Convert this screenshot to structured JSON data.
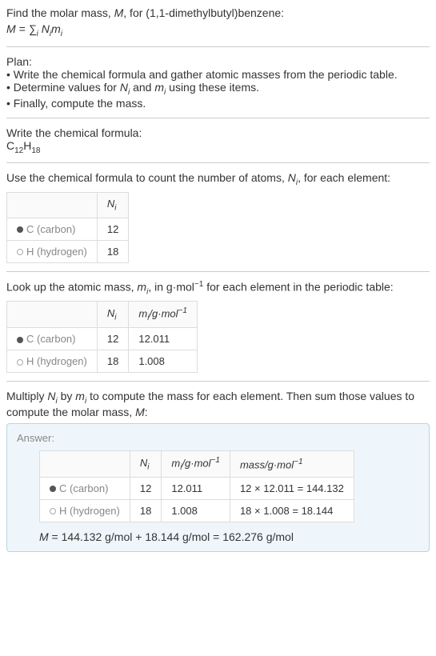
{
  "intro": {
    "line1_pre": "Find the molar mass, ",
    "line1_var": "M",
    "line1_post": ", for (1,1-dimethylbutyl)benzene:",
    "formula_lhs": "M = ",
    "formula_sum": "∑",
    "formula_sub": "i",
    "formula_rhs_pre": " N",
    "formula_rhs_sub1": "i",
    "formula_rhs_mid": "m",
    "formula_rhs_sub2": "i"
  },
  "plan": {
    "title": "Plan:",
    "item1": "• Write the chemical formula and gather atomic masses from the periodic table.",
    "item2_pre": "• Determine values for ",
    "item2_n": "N",
    "item2_nsub": "i",
    "item2_mid": " and ",
    "item2_m": "m",
    "item2_msub": "i",
    "item2_post": " using these items.",
    "item3": "• Finally, compute the mass."
  },
  "chemFormula": {
    "title": "Write the chemical formula:",
    "c": "C",
    "c_sub": "12",
    "h": "H",
    "h_sub": "18"
  },
  "countAtoms": {
    "intro_pre": "Use the chemical formula to count the number of atoms, ",
    "intro_n": "N",
    "intro_nsub": "i",
    "intro_post": ", for each element:",
    "header_n": "N",
    "header_nsub": "i",
    "rows": [
      {
        "name": "C (carbon)",
        "dot": "dot-c",
        "n": "12"
      },
      {
        "name": "H (hydrogen)",
        "dot": "dot-h",
        "n": "18"
      }
    ]
  },
  "atomicMass": {
    "intro_pre": "Look up the atomic mass, ",
    "intro_m": "m",
    "intro_msub": "i",
    "intro_mid": ", in g·mol",
    "intro_sup": "−1",
    "intro_post": " for each element in the periodic table:",
    "header_n": "N",
    "header_nsub": "i",
    "header_m": "m",
    "header_msub": "i",
    "header_unit": "/g·mol",
    "header_sup": "−1",
    "rows": [
      {
        "name": "C (carbon)",
        "dot": "dot-c",
        "n": "12",
        "m": "12.011"
      },
      {
        "name": "H (hydrogen)",
        "dot": "dot-h",
        "n": "18",
        "m": "1.008"
      }
    ]
  },
  "multiply": {
    "intro_pre": "Multiply ",
    "intro_n": "N",
    "intro_nsub": "i",
    "intro_mid1": " by ",
    "intro_m": "m",
    "intro_msub": "i",
    "intro_mid2": " to compute the mass for each element. Then sum those values to compute the molar mass, ",
    "intro_mvar": "M",
    "intro_post": ":"
  },
  "answer": {
    "label": "Answer:",
    "header_n": "N",
    "header_nsub": "i",
    "header_m": "m",
    "header_msub": "i",
    "header_unit": "/g·mol",
    "header_sup": "−1",
    "header_mass": "mass/g·mol",
    "header_mass_sup": "−1",
    "rows": [
      {
        "name": "C (carbon)",
        "dot": "dot-c",
        "n": "12",
        "m": "12.011",
        "mass": "12 × 12.011 = 144.132"
      },
      {
        "name": "H (hydrogen)",
        "dot": "dot-h",
        "n": "18",
        "m": "1.008",
        "mass": "18 × 1.008 = 18.144"
      }
    ],
    "final_var": "M",
    "final_eq": " = 144.132 g/mol + 18.144 g/mol = 162.276 g/mol"
  }
}
